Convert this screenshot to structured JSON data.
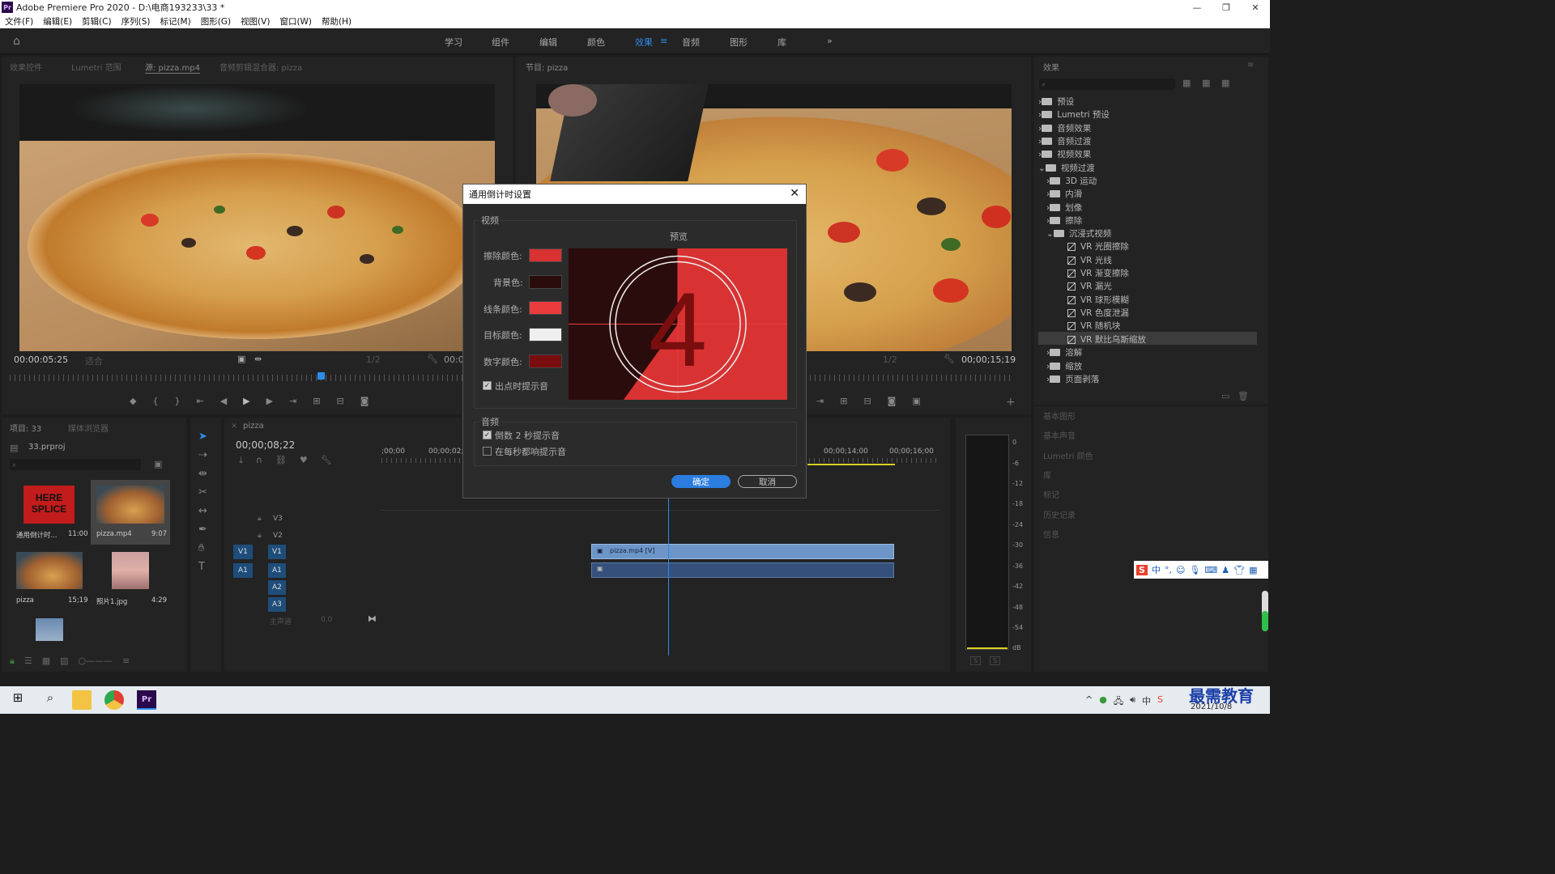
{
  "window": {
    "title": "Adobe Premiere Pro 2020 - D:\\电商193233\\33 *",
    "logo": "Pr"
  },
  "menu": [
    "文件(F)",
    "编辑(E)",
    "剪辑(C)",
    "序列(S)",
    "标记(M)",
    "图形(G)",
    "视图(V)",
    "窗口(W)",
    "帮助(H)"
  ],
  "workspaces": [
    "学习",
    "组件",
    "编辑",
    "颜色",
    "效果",
    "音频",
    "图形",
    "库"
  ],
  "workspace_active": "效果",
  "source_tabs": [
    "效果控件",
    "Lumetri 范围",
    "源: pizza.mp4",
    "音频剪辑混合器: pizza"
  ],
  "program_tab": "节目: pizza",
  "effects_tab": "效果",
  "source": {
    "timecode": "00:00:05:25",
    "fit": "适合",
    "ratio": "1/2",
    "right_tc": "00:0"
  },
  "program": {
    "timecode": "00;00;15;19",
    "ratio": "1/2"
  },
  "project": {
    "tab": "项目: 33",
    "browser": "媒体浏览器",
    "file": "33.prproj",
    "items": [
      {
        "name": "通用倒计时...",
        "dur": "11:00"
      },
      {
        "name": "pizza.mp4",
        "dur": "9:07"
      },
      {
        "name": "pizza",
        "dur": "15;19"
      },
      {
        "name": "照片1.jpg",
        "dur": "4:29"
      }
    ],
    "splice_text": "HERE SPLICE"
  },
  "timeline": {
    "tab": "pizza",
    "timecode": "00;00;08;22",
    "ruler": [
      ";00;00",
      "00;00;02;0",
      "00;00;14;00",
      "00;00;16;00"
    ],
    "tracks": [
      "V3",
      "V2",
      "V1",
      "A1",
      "A2",
      "A3"
    ],
    "master": "主声道",
    "master_val": "0.0",
    "clip": "pizza.mp4 [V]"
  },
  "meter": {
    "scale": [
      "0",
      "-6",
      "-12",
      "-18",
      "-24",
      "-30",
      "-36",
      "-42",
      "-48",
      "-54",
      "dB"
    ],
    "s1": "S",
    "s2": "S"
  },
  "effects": {
    "items": [
      "预设",
      "Lumetri 预设",
      "音频效果",
      "音频过渡",
      "视频效果",
      "视频过渡"
    ],
    "sub": [
      "3D 运动",
      "内滑",
      "划像",
      "擦除",
      "沉浸式视频"
    ],
    "vr": [
      "VR 光圈擦除",
      "VR 光线",
      "VR 渐变擦除",
      "VR 漏光",
      "VR 球形模糊",
      "VR 色度泄漏",
      "VR 随机块",
      "VR 默比乌斯缩放"
    ],
    "after": [
      "溶解",
      "缩放",
      "页面剥落"
    ],
    "panels": [
      "基本图形",
      "基本声音",
      "Lumetri 颜色",
      "库",
      "标记",
      "历史记录",
      "信息"
    ]
  },
  "dialog": {
    "title": "通用倒计时设置",
    "video_label": "视频",
    "preview_label": "预览",
    "wipe": "擦除颜色:",
    "bg": "背景色:",
    "line": "线条颜色:",
    "target": "目标颜色:",
    "number": "数字颜色:",
    "cue_out": "出点时提示音",
    "audio_label": "音频",
    "cue2": "倒数 2 秒提示音",
    "cue_each": "在每秒都响提示音",
    "ok": "确定",
    "cancel": "取消",
    "digit": "4",
    "colors": {
      "wipe": "#d83232",
      "bg": "#2b0c0c",
      "line": "#ea3c3c",
      "target": "#efefef",
      "number": "#7a0e0e"
    }
  },
  "taskbar": {
    "time": "2021/10/8",
    "brand": "最需教育"
  }
}
